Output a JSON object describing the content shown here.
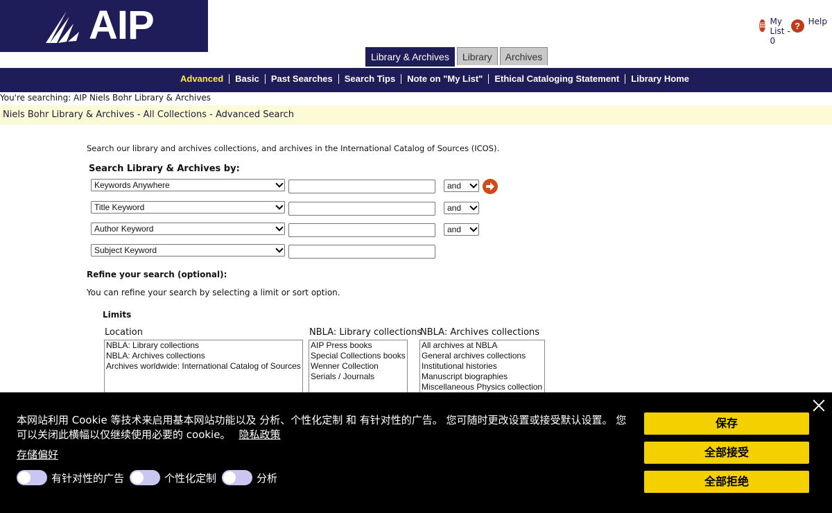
{
  "logo": {
    "text": "AIP"
  },
  "toplinks": {
    "my_list": "My List - 0",
    "help": "Help"
  },
  "tabs": [
    "Library & Archives",
    "Library",
    "Archives"
  ],
  "nav": [
    "Advanced",
    "Basic",
    "Past Searches",
    "Search Tips",
    "Note on \"My List\"",
    "Ethical Cataloging Statement",
    "Library Home"
  ],
  "searching": {
    "label": "You're searching:",
    "value": "AIP Niels Bohr Library & Archives"
  },
  "banner": "Niels Bohr Library & Archives - All Collections - Advanced Search",
  "intro": "Search our library and archives collections, and archives in the International Catalog of Sources (ICOS).",
  "search_heading": "Search Library & Archives by:",
  "rows": [
    {
      "field": "Keywords Anywhere",
      "bool": "and"
    },
    {
      "field": "Title Keyword",
      "bool": "and"
    },
    {
      "field": "Author Keyword",
      "bool": "and"
    },
    {
      "field": "Subject Keyword"
    }
  ],
  "refine": {
    "heading": "Refine your search (optional):",
    "text": "You can refine your search by selecting a limit or sort option."
  },
  "limits": {
    "heading": "Limits",
    "location": {
      "label": "Location",
      "options": [
        "NBLA: Library collections",
        "NBLA: Archives collections",
        "Archives worldwide: International Catalog of Sources"
      ]
    },
    "library": {
      "label": "NBLA: Library collections",
      "options": [
        "AIP Press books",
        "Special Collections books",
        "Wenner Collection",
        "Serials / Journals"
      ]
    },
    "archives": {
      "label": "NBLA: Archives collections",
      "options": [
        "All archives at NBLA",
        "General archives collections",
        "Institutional histories",
        "Manuscript biographies",
        "Miscellaneous Physics collection"
      ]
    }
  },
  "cookie": {
    "message": "本网站利用 Cookie 等技术来启用基本网站功能以及 分析、个性化定制 和 有针对性的广告。 您可随时更改设置或接受默认设置。 您可以关闭此横幅以仅继续使用必要的 cookie。",
    "privacy": "隐私政策",
    "prefs": "存储偏好",
    "toggles": [
      "有针对性的广告",
      "个性化定制",
      "分析"
    ],
    "buttons": [
      "保存",
      "全部接受",
      "全部拒绝"
    ]
  }
}
